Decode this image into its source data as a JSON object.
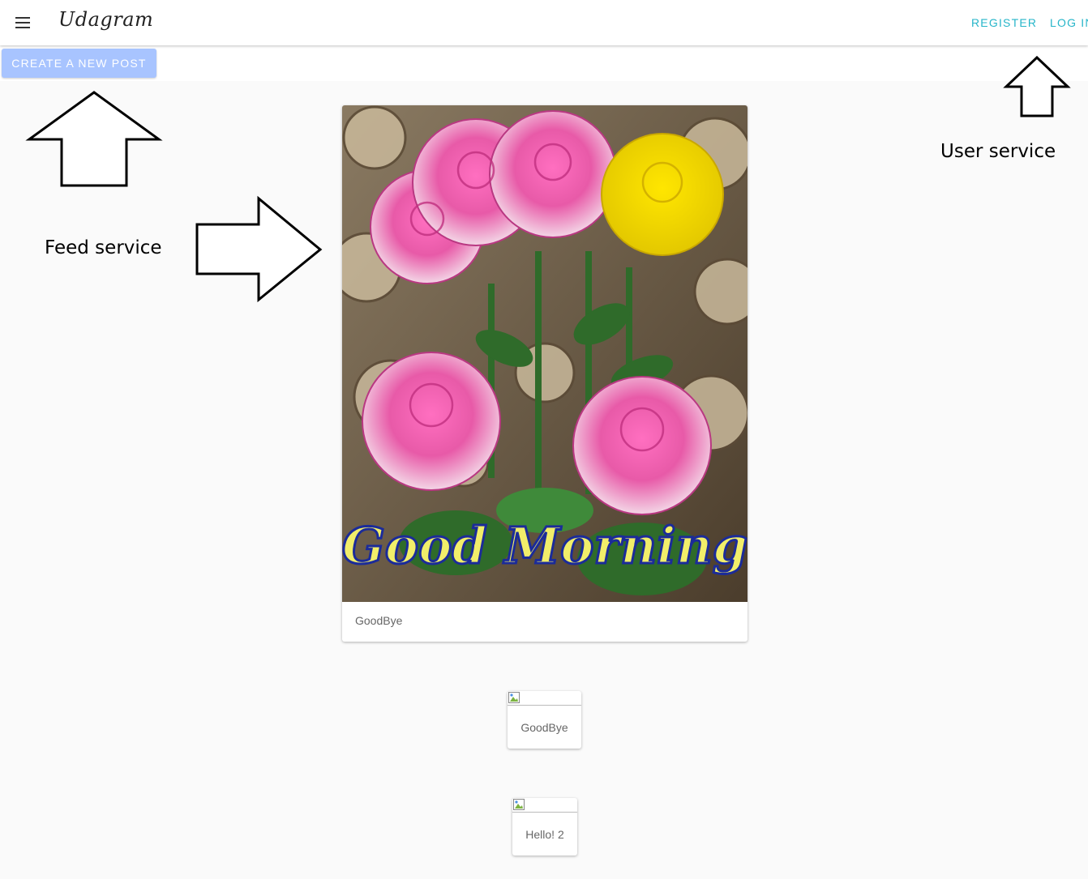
{
  "app": {
    "title": "Udagram"
  },
  "toolbar": {
    "menu_icon": "hamburger-menu-icon",
    "register_label": "REGISTER",
    "login_label": "LOG IN"
  },
  "actions": {
    "create_post_label": "CREATE A NEW POST"
  },
  "annotations": {
    "feed_label": "Feed service",
    "user_label": "User service",
    "arrow_color": "#000000"
  },
  "feed": {
    "items": [
      {
        "caption": "GoodBye",
        "image_alt": "Good Morning roses photo",
        "image_text": "Good Morning"
      },
      {
        "caption": "GoodBye",
        "image_alt": ""
      },
      {
        "caption": "Hello! 2",
        "image_alt": ""
      }
    ]
  },
  "colors": {
    "accent": "#26b5c9",
    "create_button": "#a8c4ff",
    "background": "#fafafa"
  }
}
